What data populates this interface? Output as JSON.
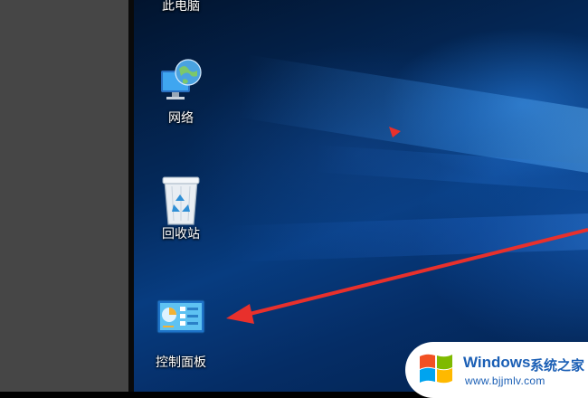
{
  "desktop": {
    "icons": [
      {
        "label": "此电脑",
        "icon": "this-pc-icon"
      },
      {
        "label": "网络",
        "icon": "network-icon"
      },
      {
        "label": "回收站",
        "icon": "recycle-bin-icon"
      },
      {
        "label": "控制面板",
        "icon": "control-panel-icon"
      }
    ]
  },
  "annotation": {
    "color": "#e8302c"
  },
  "watermark": {
    "brand": "Windows",
    "brand_cn": "系统之家",
    "url": "www.bjjmlv.com"
  }
}
